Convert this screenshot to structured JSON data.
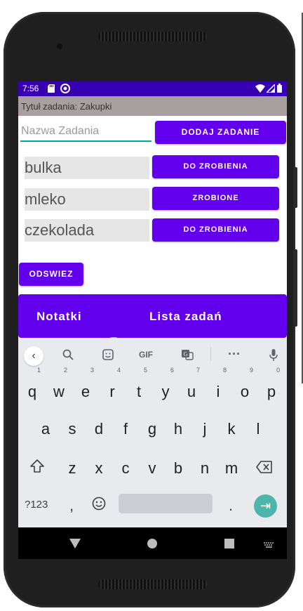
{
  "status_bar": {
    "time": "7:56",
    "icons_left": [
      "sd-card-icon",
      "sync-icon"
    ],
    "icons_right": [
      "wifi-icon",
      "signal-icon",
      "battery-icon"
    ]
  },
  "title_bar": {
    "text": "Tytuł zadania: Zakupki"
  },
  "task_input": {
    "placeholder": "Nazwa Zadania",
    "value": ""
  },
  "add_button": {
    "label": "DODAJ ZADANIE"
  },
  "tasks": [
    {
      "name": "bulka",
      "status": "DO ZROBIENIA"
    },
    {
      "name": "mleko",
      "status": "ZROBIONE"
    },
    {
      "name": "czekolada",
      "status": "DO ZROBIENIA"
    }
  ],
  "refresh_button": {
    "label": "ODSWIEZ"
  },
  "bottom_nav": {
    "tabs": [
      "Notatki",
      "Lista zadań"
    ]
  },
  "keyboard": {
    "toolbar": [
      "back-icon",
      "search-icon",
      "sticker-icon",
      "GIF",
      "translate-icon",
      "more-icon",
      "mic-icon"
    ],
    "row1": [
      "q",
      "w",
      "e",
      "r",
      "t",
      "y",
      "u",
      "i",
      "o",
      "p"
    ],
    "row1_hints": [
      "1",
      "2",
      "3",
      "4",
      "5",
      "6",
      "7",
      "8",
      "9",
      "0"
    ],
    "row2": [
      "a",
      "s",
      "d",
      "f",
      "g",
      "h",
      "j",
      "k",
      "l"
    ],
    "row3": [
      "z",
      "x",
      "c",
      "v",
      "b",
      "n",
      "m"
    ],
    "symbols_key": "?123",
    "comma": ",",
    "period": "."
  },
  "colors": {
    "primary": "#6200ee",
    "status_bar": "#3700b3",
    "title_bar": "#a8a0a0",
    "accent": "#00a99d",
    "enter": "#4db6ac"
  }
}
